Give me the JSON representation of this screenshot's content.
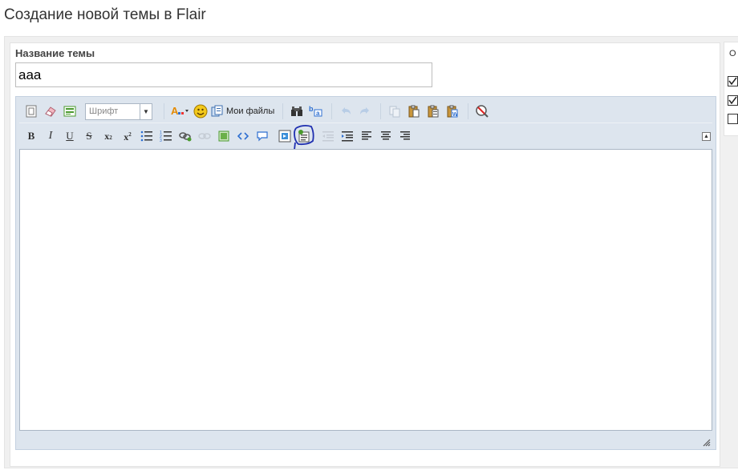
{
  "page": {
    "title": "Создание новой темы в Flair"
  },
  "form": {
    "title_label": "Название темы",
    "title_value": "aaa"
  },
  "editor": {
    "font_select": {
      "value": "Шрифт"
    },
    "my_files_label": "Мои файлы",
    "toolbar_row1": [
      "source-icon",
      "eraser-icon",
      "template-icon",
      "font-select",
      "font-color-icon",
      "smiley-icon",
      "my-files-button",
      "find-icon",
      "replace-icon",
      "undo-icon",
      "redo-icon",
      "copy-icon",
      "paste-icon",
      "paste-text-icon",
      "paste-word-icon",
      "spellcheck-icon"
    ],
    "toolbar_row2": [
      "bold-icon",
      "italic-icon",
      "underline-icon",
      "strike-icon",
      "subscript-icon",
      "superscript-icon",
      "bulleted-list-icon",
      "numbered-list-icon",
      "link-icon",
      "unlink-icon",
      "image-icon",
      "code-icon",
      "quote-icon",
      "media-icon",
      "spoiler-icon",
      "outdent-icon",
      "indent-icon",
      "align-left-icon",
      "align-center-icon",
      "align-right-icon"
    ],
    "highlighted_button": "spoiler-icon",
    "highlight_color": "#1f2fb0",
    "body_text": ""
  },
  "side_panel": {
    "label": "О",
    "checkboxes": [
      {
        "checked": true
      },
      {
        "checked": true
      },
      {
        "checked": false
      }
    ]
  },
  "colors": {
    "toolbar_bg": "#dde5ee",
    "border": "#c4d1e0",
    "accent_green": "#4a9a2e",
    "smiley_yellow": "#f2c81a"
  }
}
